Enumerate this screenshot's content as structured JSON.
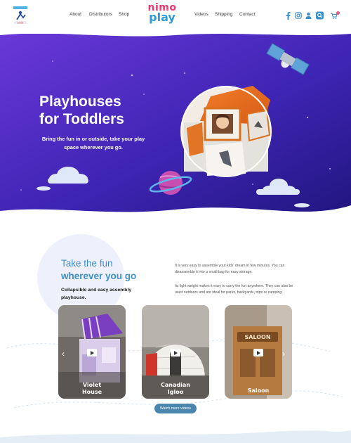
{
  "nav": {
    "left": [
      "About",
      "Distributors",
      "Shop"
    ],
    "right": [
      "Videos",
      "Shipping",
      "Contact"
    ]
  },
  "brand": {
    "line1": "nimo",
    "line2": "play"
  },
  "cart_count": "0",
  "hero": {
    "title_line1": "Playhouses",
    "title_line2": "for Toddlers",
    "subtitle": "Bring the fun in or outside, take your play space wherever you go."
  },
  "intro": {
    "heading_line1": "Take the fun",
    "heading_line2": "wherever you go",
    "subheading": "Collapsible and easy assembly playhouse.",
    "paragraph1": "It is very easy to assemble your kids' dream in few minutes. You can disassemble it into a small bag for easy storage.",
    "paragraph2": "Its light weight makes it easy to carry the fun anywhere. They can also be used outdoors and are ideal for parks, backyards, trips or camping."
  },
  "cards": [
    {
      "line1": "Violet",
      "line2": "House"
    },
    {
      "line1": "Canadian",
      "line2": "Igloo"
    },
    {
      "line1": "Saloon",
      "line2": ""
    }
  ],
  "watch_button": "Watch more videos",
  "colors": {
    "hero_top": "#6a38d8",
    "hero_bottom": "#281887",
    "accent_blue": "#3d8fc9",
    "button": "#4a86ad",
    "brand_pink": "#e8386e"
  }
}
